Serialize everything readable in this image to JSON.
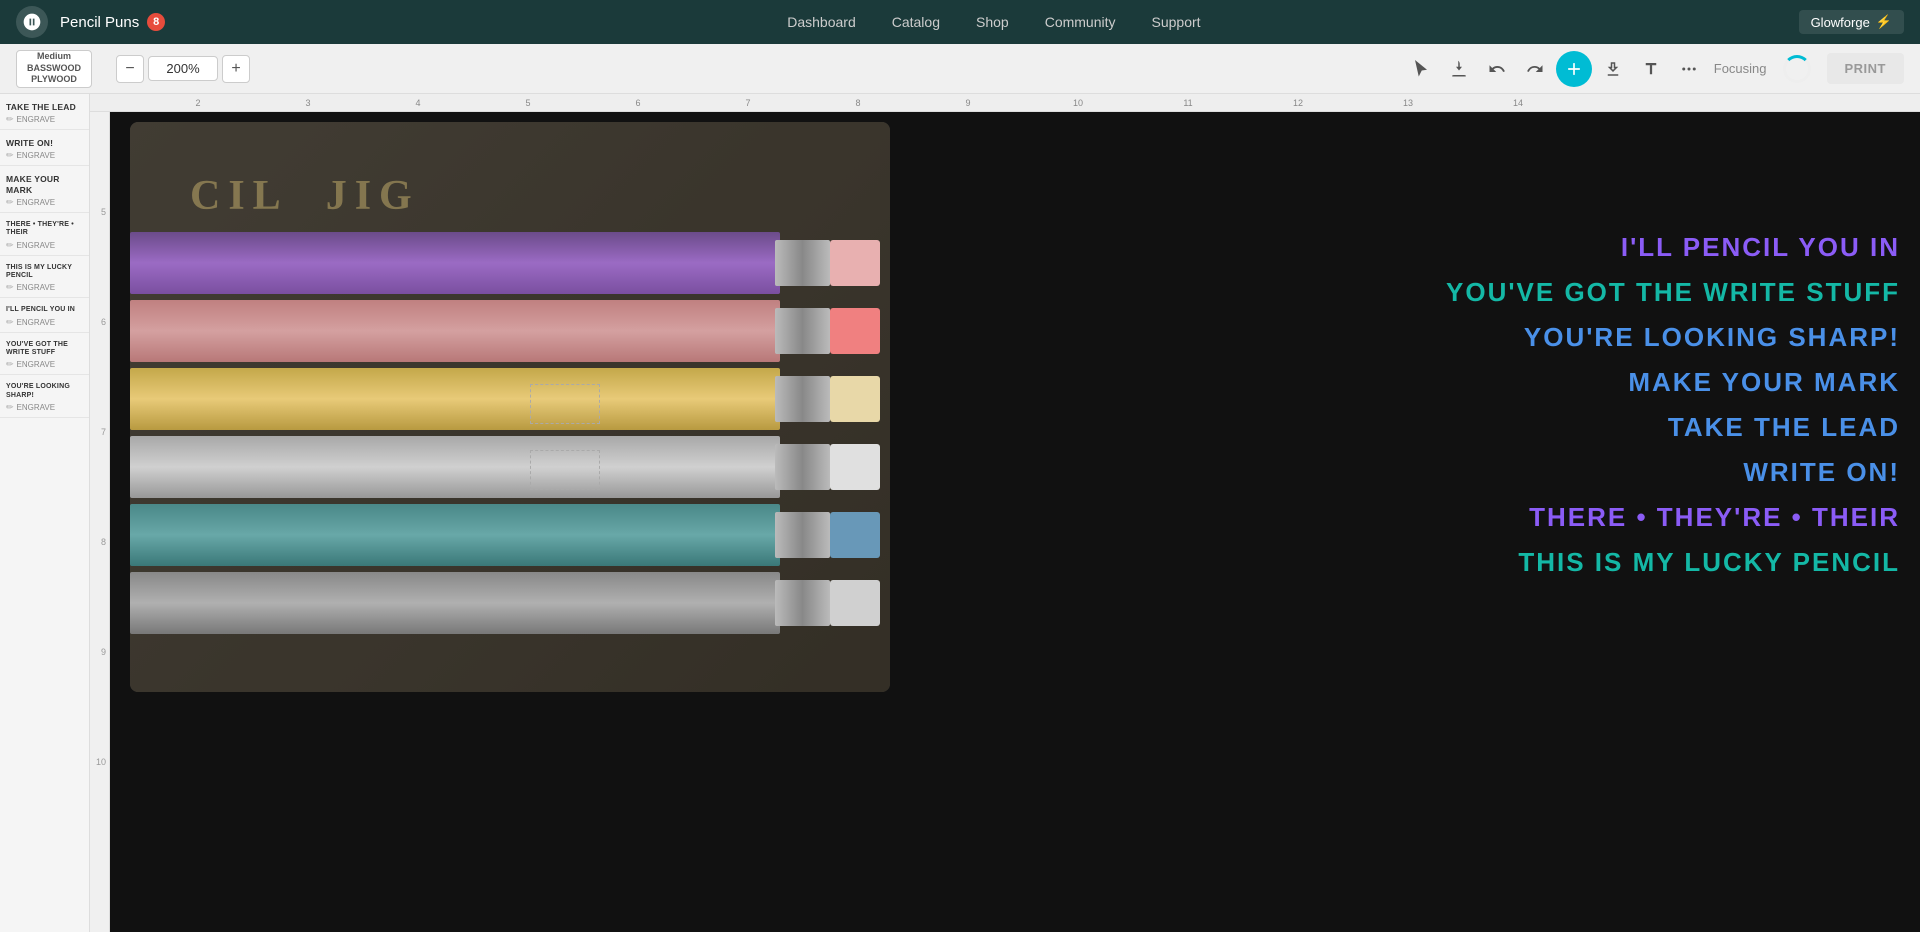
{
  "app": {
    "logo_text": "G",
    "title": "Pencil Puns",
    "badge_count": "8"
  },
  "nav": {
    "links": [
      "Dashboard",
      "Catalog",
      "Shop",
      "Community",
      "Support"
    ],
    "glowforge_label": "Glowforge",
    "glowforge_suffix": "⚡"
  },
  "toolbar": {
    "material_line1": "Medium",
    "material_line2": "BASSWOOD",
    "material_line3": "PLYWOOD",
    "zoom_value": "200%",
    "zoom_minus": "−",
    "zoom_plus": "+",
    "focusing_label": "Focusing",
    "print_label": "PRINT"
  },
  "left_panel": {
    "items": [
      {
        "title": "TAKE THE LEAD",
        "sub": "ENGRAVE"
      },
      {
        "title": "WRITE ON!",
        "sub": "ENGRAVE"
      },
      {
        "title": "MAKE YOUR MARK",
        "sub": "ENGRAVE"
      },
      {
        "title": "THERE • THEY'RE • THEIR",
        "sub": "ENGRAVE"
      },
      {
        "title": "THIS IS MY LUCKY PENCIL",
        "sub": "ENGRAVE"
      },
      {
        "title": "I'LL PENCIL YOU IN",
        "sub": "ENGRAVE"
      },
      {
        "title": "YOU'VE GOT THE WRITE STUFF",
        "sub": "ENGRAVE"
      },
      {
        "title": "YOU'RE LOOKING SHARP!",
        "sub": "ENGRAVE"
      }
    ]
  },
  "ruler": {
    "h_marks": [
      2,
      3,
      4,
      5,
      6,
      7,
      8,
      9,
      10,
      11,
      12,
      13,
      14
    ],
    "v_marks": [
      5,
      6,
      7,
      8,
      9,
      10
    ]
  },
  "canvas": {
    "text_items": [
      {
        "text": "I'LL PENCIL YOU IN",
        "color": "purple"
      },
      {
        "text": "YOU'VE GOT THE WRITE STUFF",
        "color": "teal"
      },
      {
        "text": "YOU'RE LOOKING SHARP!",
        "color": "blue"
      },
      {
        "text": "MAKE YOUR MARK",
        "color": "blue"
      },
      {
        "text": "TAKE THE LEAD",
        "color": "blue"
      },
      {
        "text": "WRITE ON!",
        "color": "blue"
      },
      {
        "text": "THERE  •  THEY'RE  •  THEIR",
        "color": "purple"
      },
      {
        "text": "THIS IS MY LUCKY PENCIL",
        "color": "teal"
      }
    ],
    "jig_label": "CIL  JIG"
  }
}
